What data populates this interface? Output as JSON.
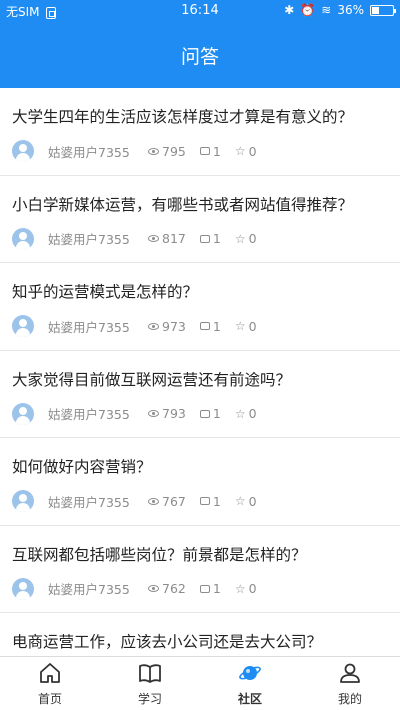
{
  "status": {
    "carrier": "无SIM",
    "time": "16:14",
    "battery": "36%"
  },
  "header": {
    "title": "问答"
  },
  "questions": [
    {
      "title": "大学生四年的生活应该怎样度过才算是有意义的？",
      "user": "姑婆用户7355",
      "views": "795",
      "comments": "1",
      "likes": "0"
    },
    {
      "title": "小白学新媒体运营，有哪些书或者网站值得推荐？",
      "user": "姑婆用户7355",
      "views": "817",
      "comments": "1",
      "likes": "0"
    },
    {
      "title": "知乎的运营模式是怎样的？",
      "user": "姑婆用户7355",
      "views": "973",
      "comments": "1",
      "likes": "0"
    },
    {
      "title": "大家觉得目前做互联网运营还有前途吗？",
      "user": "姑婆用户7355",
      "views": "793",
      "comments": "1",
      "likes": "0"
    },
    {
      "title": "如何做好内容营销？",
      "user": "姑婆用户7355",
      "views": "767",
      "comments": "1",
      "likes": "0"
    },
    {
      "title": "互联网都包括哪些岗位？前景都是怎样的？",
      "user": "姑婆用户7355",
      "views": "762",
      "comments": "1",
      "likes": "0"
    },
    {
      "title": "电商运营工作，应该去小公司还是去大公司？",
      "user": "",
      "views": "",
      "comments": "",
      "likes": ""
    }
  ],
  "tabs": [
    {
      "label": "首页",
      "icon": "home-icon"
    },
    {
      "label": "学习",
      "icon": "book-icon"
    },
    {
      "label": "社区",
      "icon": "planet-icon",
      "active": true
    },
    {
      "label": "我的",
      "icon": "user-icon"
    }
  ],
  "colors": {
    "primary": "#1e8cf2",
    "accent_icon": "#1e8cf2"
  }
}
